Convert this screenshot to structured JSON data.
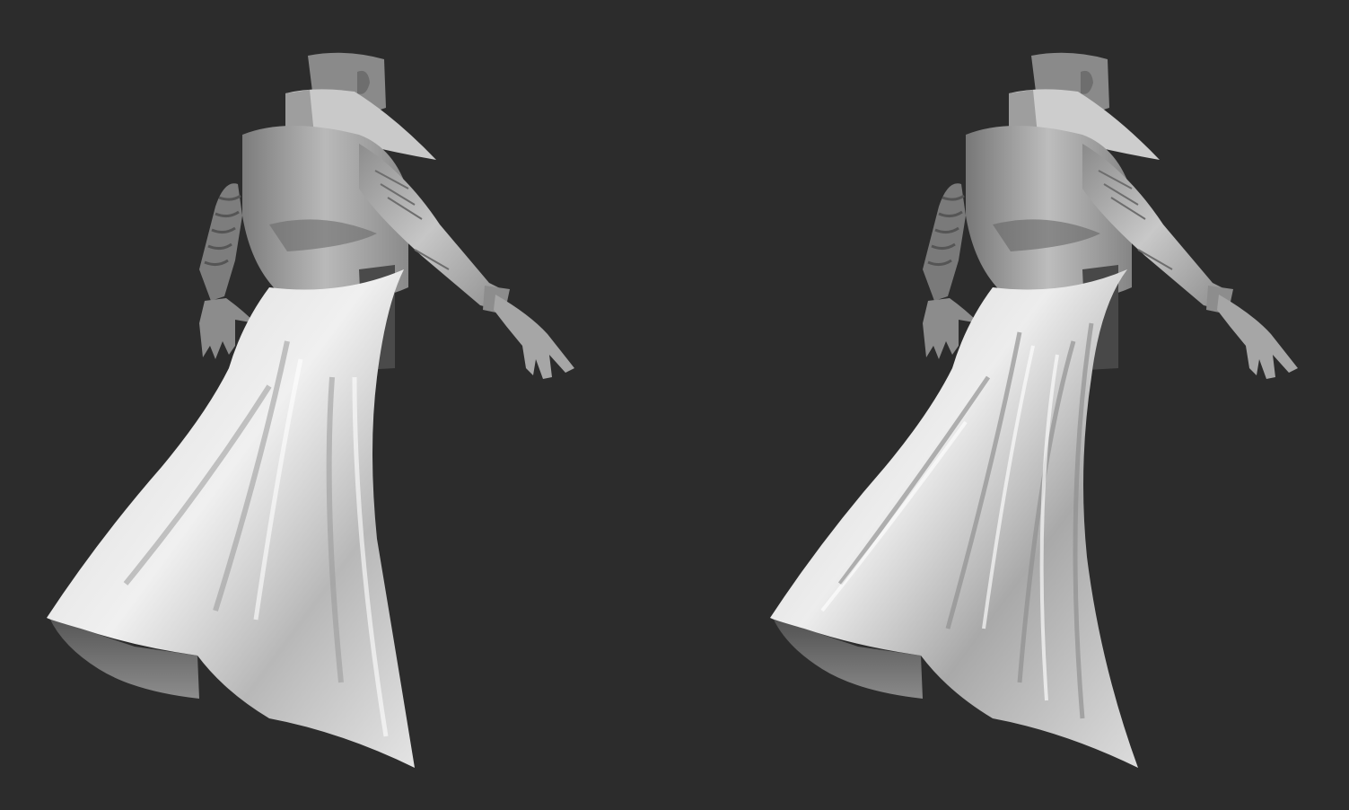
{
  "viewport": {
    "background": "#2c2c2c",
    "models": [
      {
        "id": "left",
        "variant": "before"
      },
      {
        "id": "right",
        "variant": "after"
      }
    ]
  },
  "palette": {
    "cloth_light": "#e9e9e9",
    "cloth_mid": "#b4b4b4",
    "cloth_dark": "#5a5a5a",
    "skin": "#9b9b9b",
    "inner_shadow": "#3a3a3a"
  }
}
